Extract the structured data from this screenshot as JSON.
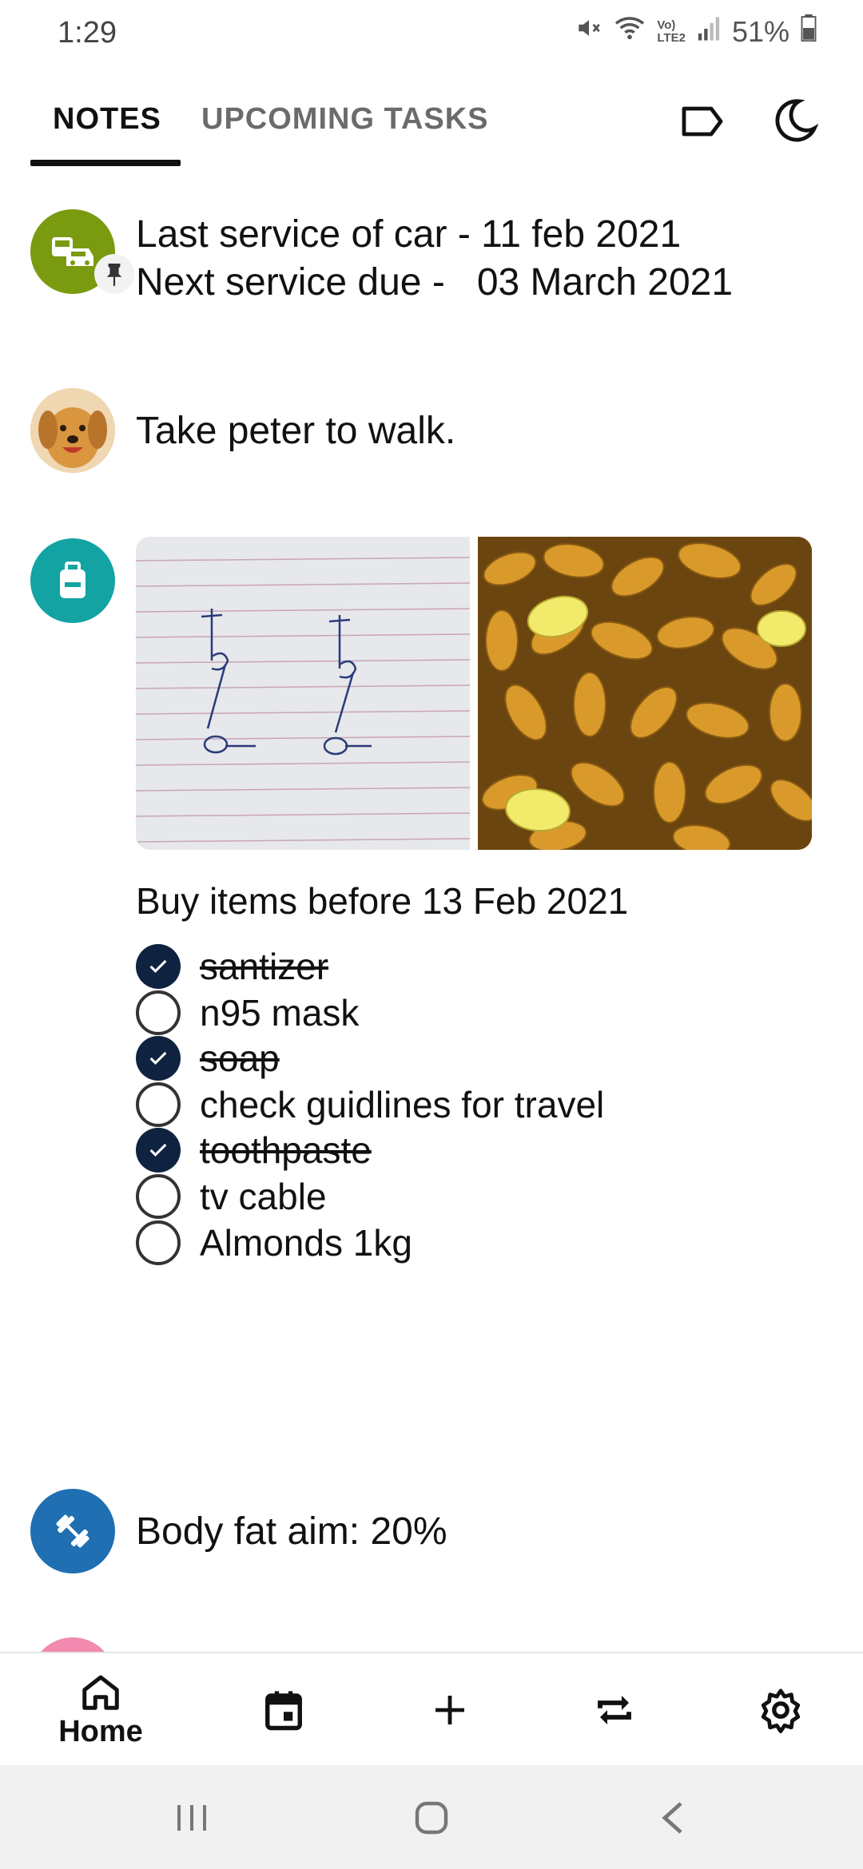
{
  "status_bar": {
    "time": "1:29",
    "battery_percent": "51%",
    "network_label_top": "Vo)",
    "network_label_bottom": "LTE2",
    "icons": [
      "mute-icon",
      "wifi-icon",
      "volte-icon",
      "signal-icon",
      "battery-icon"
    ]
  },
  "tabs": [
    {
      "label": "NOTES",
      "selected": true
    },
    {
      "label": "UPCOMING TASKS",
      "selected": false
    }
  ],
  "header_icons": [
    "label-icon",
    "dark-mode-icon"
  ],
  "notes": [
    {
      "icon": "car-icon",
      "icon_color": "#7a9a10",
      "pinned": true,
      "lines": [
        "Last service of car - 11 feb 2021",
        "Next service due -   03 March 2021"
      ]
    },
    {
      "icon": "dog-photo-avatar",
      "text": "Take peter to walk."
    },
    {
      "icon": "backpack-icon",
      "icon_color": "#13a3a3",
      "images": [
        "handwritten-sketch-image",
        "almonds-image"
      ],
      "title": "Buy items before 13 Feb 2021",
      "checklist": [
        {
          "label": "santizer",
          "checked": true
        },
        {
          "label": "n95 mask",
          "checked": false
        },
        {
          "label": "soap",
          "checked": true
        },
        {
          "label": "check guidlines for travel",
          "checked": false
        },
        {
          "label": "toothpaste",
          "checked": true
        },
        {
          "label": "tv cable",
          "checked": false
        },
        {
          "label": "Almonds 1kg",
          "checked": false
        }
      ]
    },
    {
      "icon": "dumbbell-icon",
      "icon_color": "#1f6fb2",
      "text": "Body fat aim: 20%"
    }
  ],
  "bottom_nav": {
    "home_label": "Home",
    "items": [
      "home-icon",
      "calendar-icon",
      "add-icon",
      "repeat-icon",
      "settings-icon"
    ]
  },
  "colors": {
    "accent_dark": "#0f2240",
    "tab_inactive": "#6b6b6b"
  }
}
